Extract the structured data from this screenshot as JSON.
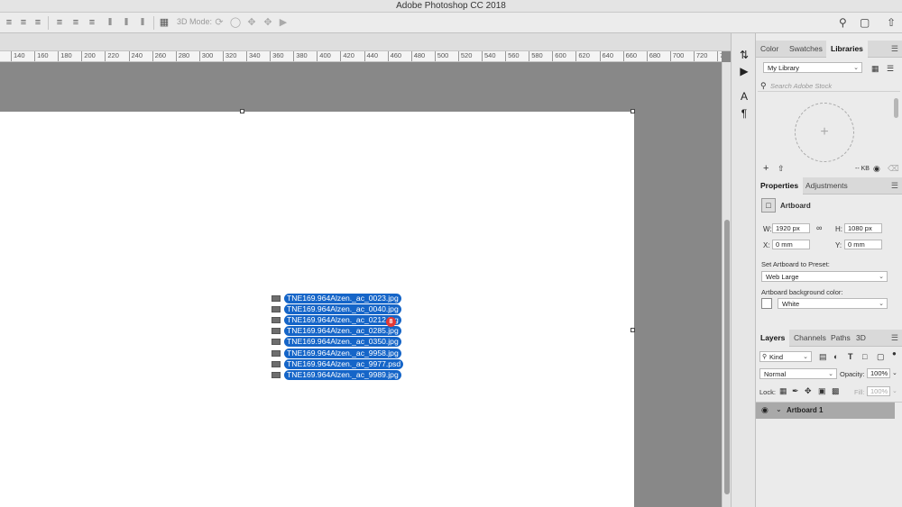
{
  "app": {
    "title": "Adobe Photoshop CC 2018"
  },
  "options_bar": {
    "mode_3d_label": "3D Mode:"
  },
  "ruler": {
    "ticks": [
      "140",
      "160",
      "180",
      "200",
      "220",
      "240",
      "260",
      "280",
      "300",
      "320",
      "340",
      "360",
      "380",
      "400",
      "420",
      "440",
      "460",
      "480",
      "500",
      "520",
      "540",
      "560",
      "580",
      "600",
      "620",
      "640",
      "660",
      "680",
      "700",
      "720",
      "740"
    ]
  },
  "canvas": {
    "drag_badge_count": "8",
    "dragged_files": [
      "TNE169.964Alzen._ac_0023.jpg",
      "TNE169.964Alzen._ac_0040.jpg",
      "TNE169.964Alzen._ac_0212.jpg",
      "TNE169.964Alzen._ac_0285.jpg",
      "TNE169.964Alzen._ac_0350.jpg",
      "TNE169.964Alzen._ac_9958.jpg",
      "TNE169.964Alzen._ac_9977.psd",
      "TNE169.964Alzen._ac_9989.jpg"
    ]
  },
  "libraries_panel": {
    "tabs": [
      "Color",
      "Swatches",
      "Libraries"
    ],
    "active_tab": "Libraries",
    "library_select": "My Library",
    "search_placeholder": "Search Adobe Stock",
    "size_label": "-- KB",
    "add_label": "+"
  },
  "properties_panel": {
    "tabs": [
      "Properties",
      "Adjustments"
    ],
    "type_label": "Artboard",
    "w_label": "W:",
    "w_value": "1920 px",
    "h_label": "H:",
    "h_value": "1080 px",
    "x_label": "X:",
    "x_value": "0 mm",
    "y_label": "Y:",
    "y_value": "0 mm",
    "preset_label": "Set Artboard to Preset:",
    "preset_value": "Web Large",
    "bg_label": "Artboard background color:",
    "bg_value": "White"
  },
  "layers_panel": {
    "tabs": [
      "Layers",
      "Channels",
      "Paths",
      "3D"
    ],
    "kind_label": "Kind",
    "blend_mode": "Normal",
    "opacity_label": "Opacity:",
    "opacity_value": "100%",
    "lock_label": "Lock:",
    "fill_label": "Fill:",
    "fill_value": "100%",
    "layers": [
      {
        "name": "Artboard 1"
      }
    ]
  },
  "colors": {
    "accent": "#1565c8",
    "badge": "#e53935",
    "selected_layer": "#a9a9a9"
  }
}
